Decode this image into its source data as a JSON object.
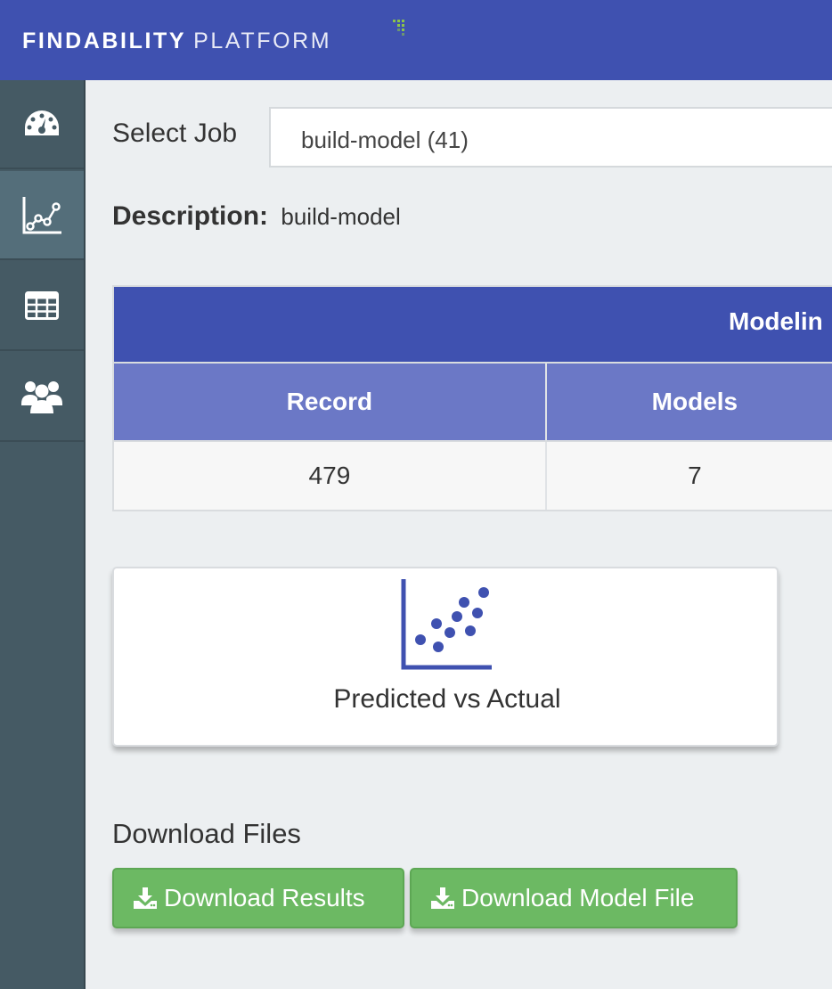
{
  "header": {
    "brand_primary": "FINDABILITY",
    "brand_secondary": "PLATFORM",
    "accent_color": "#3f51b0"
  },
  "sidebar": {
    "items": [
      {
        "icon": "dashboard-gauge-icon",
        "active": false
      },
      {
        "icon": "chart-line-icon",
        "active": true
      },
      {
        "icon": "table-grid-icon",
        "active": false
      },
      {
        "icon": "users-group-icon",
        "active": false
      }
    ]
  },
  "job": {
    "select_label": "Select Job",
    "selected_value": "build-model (41)"
  },
  "description": {
    "label": "Description:",
    "value": "build-model"
  },
  "table": {
    "title": "Modelin",
    "columns": [
      "Record",
      "Models"
    ],
    "rows": [
      [
        "479",
        "7"
      ]
    ]
  },
  "card": {
    "icon": "scatter-plot-icon",
    "title": "Predicted vs Actual"
  },
  "downloads": {
    "section_title": "Download Files",
    "results_label": "Download Results",
    "model_label": "Download Model File",
    "button_color": "#6cb963"
  }
}
